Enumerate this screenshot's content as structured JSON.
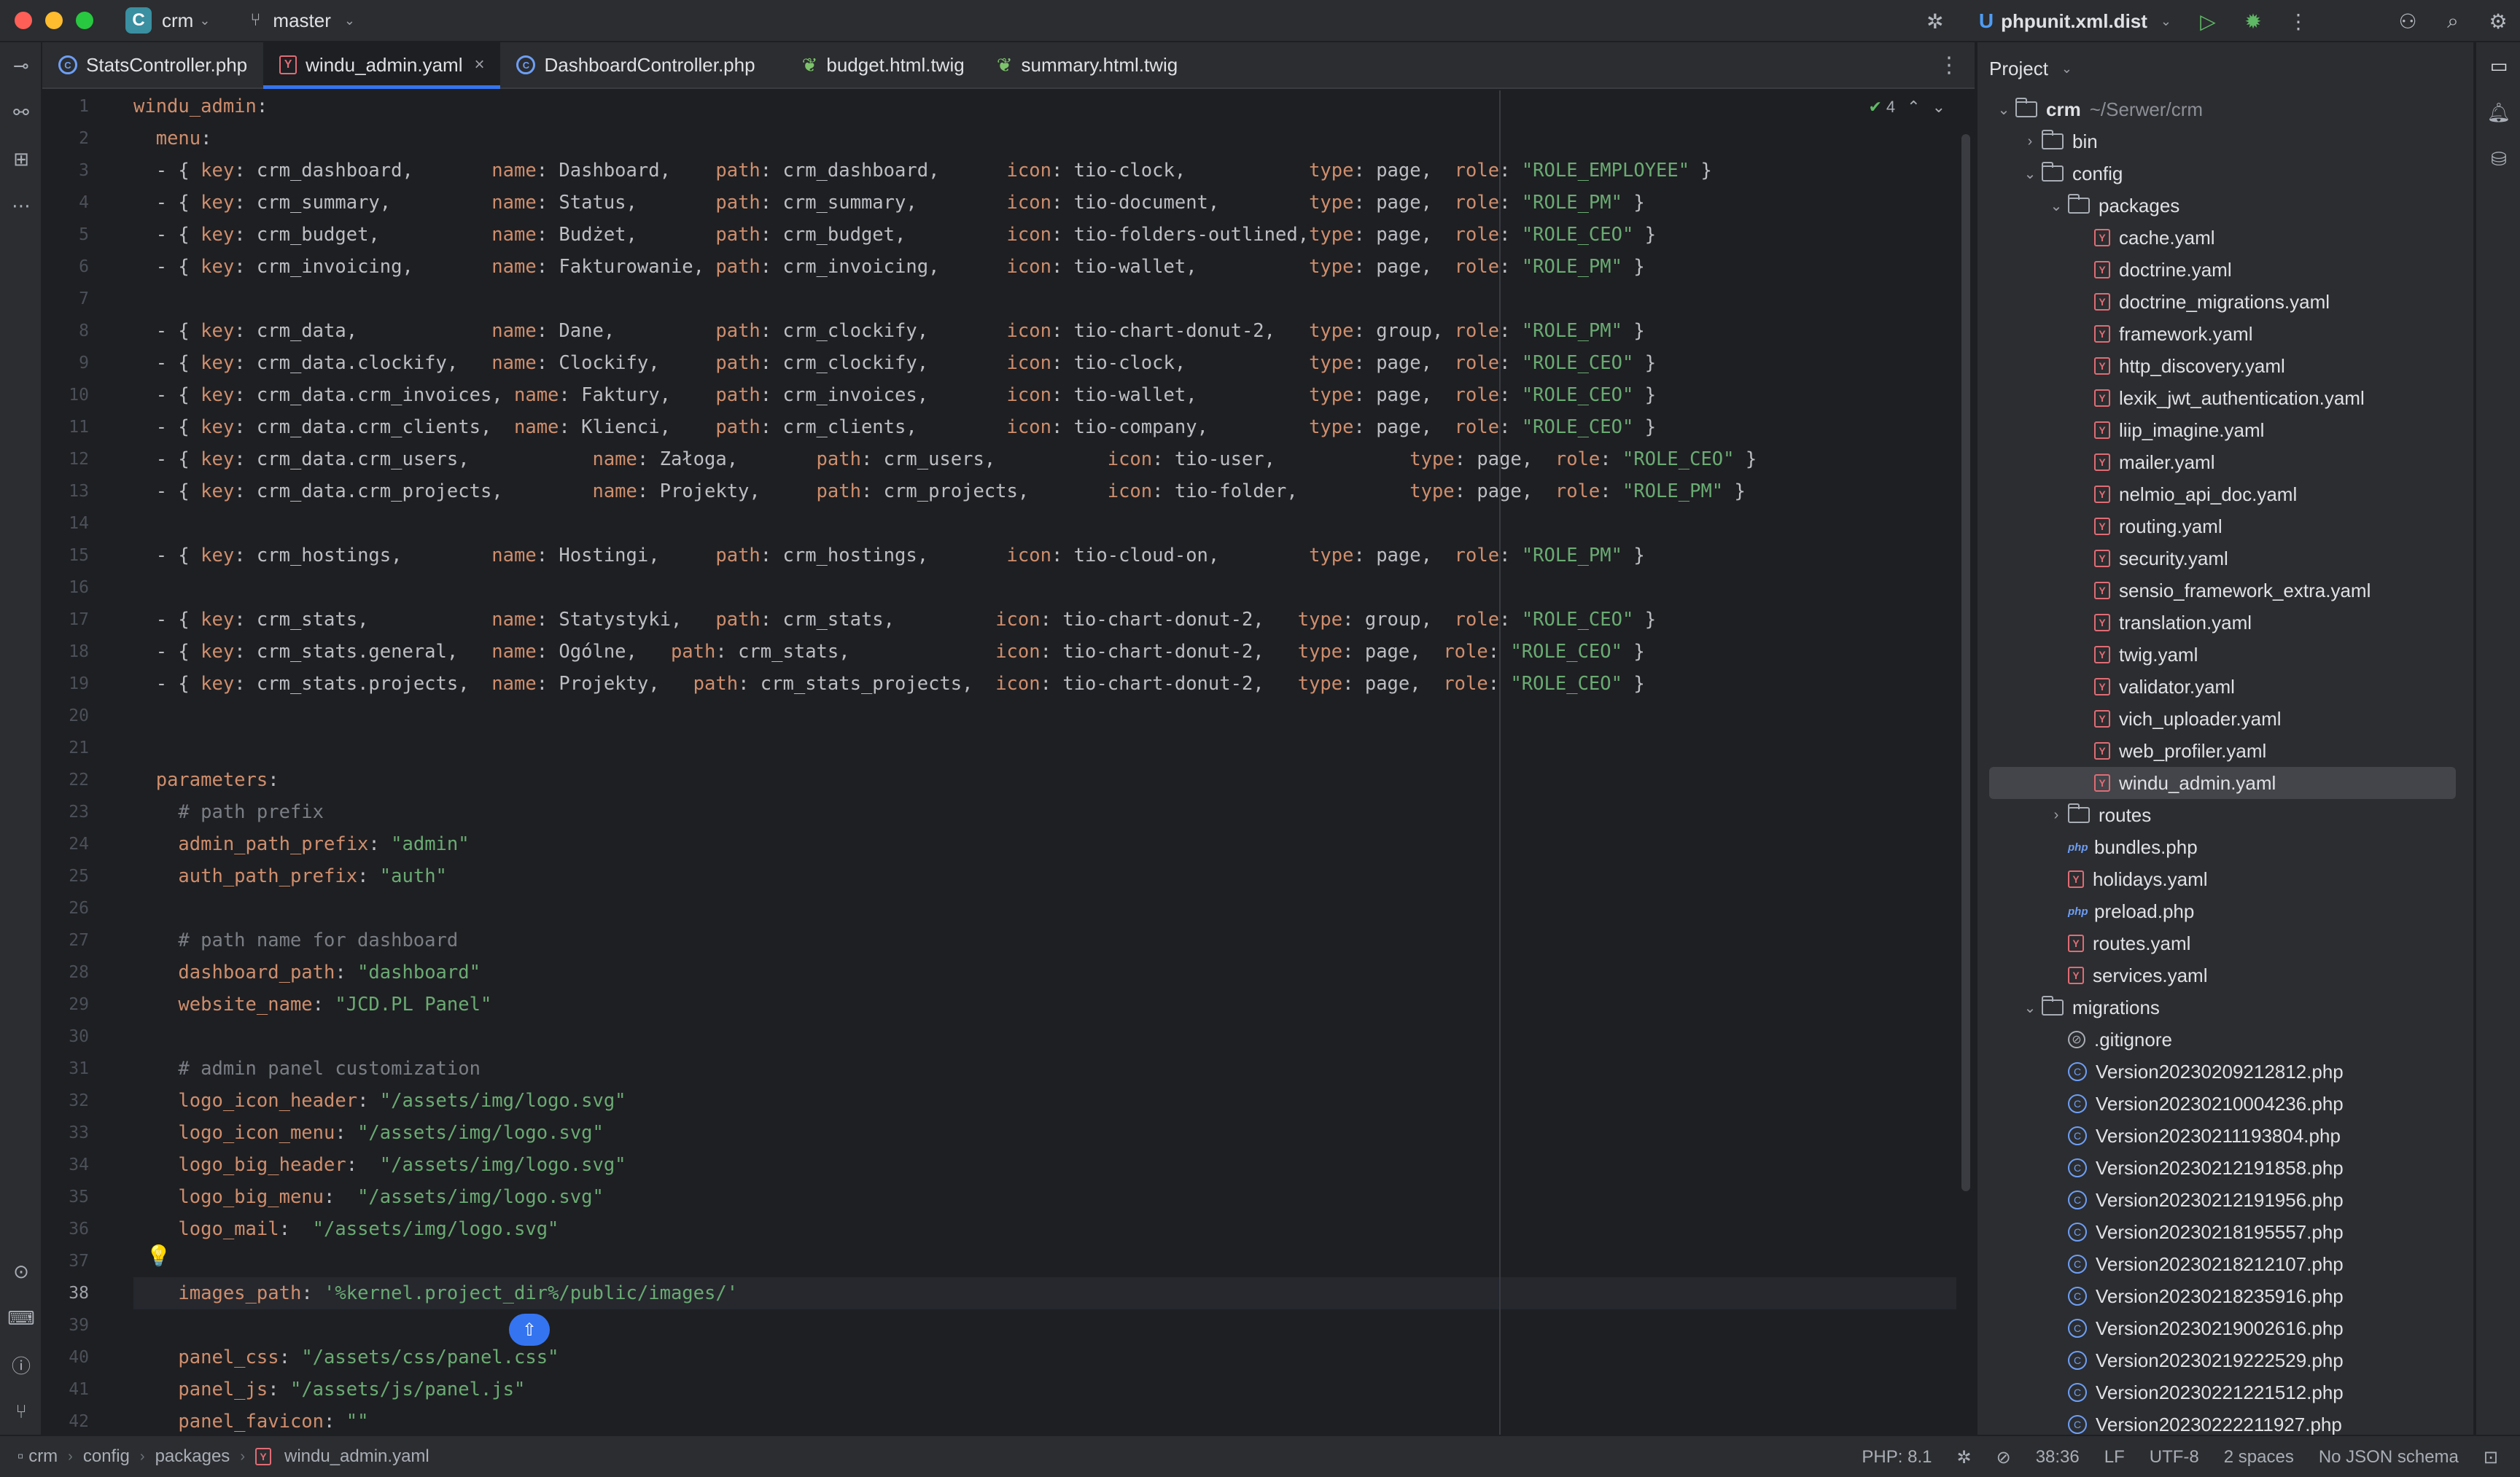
{
  "titlebar": {
    "project_badge": "C",
    "project_name": "crm",
    "branch": "master",
    "run_config": "phpunit.xml.dist",
    "colors": {
      "accent": "#3574f0",
      "run": "#5fb865"
    }
  },
  "tabs": [
    {
      "label": "StatsController.php",
      "type": "php",
      "active": false
    },
    {
      "label": "windu_admin.yaml",
      "type": "yaml",
      "active": true
    },
    {
      "label": "DashboardController.php",
      "type": "php",
      "active": false
    },
    {
      "label": "budget.html.twig",
      "type": "twig",
      "active": false
    },
    {
      "label": "summary.html.twig",
      "type": "twig",
      "active": false
    }
  ],
  "editor": {
    "inspection_count": "4",
    "current_line": 38,
    "lines": [
      "windu_admin:",
      "  menu:",
      "  - { key: crm_dashboard,       name: Dashboard,    path: crm_dashboard,      icon: tio-clock,           type: page,  role: \"ROLE_EMPLOYEE\" }",
      "  - { key: crm_summary,         name: Status,       path: crm_summary,        icon: tio-document,        type: page,  role: \"ROLE_PM\" }",
      "  - { key: crm_budget,          name: Budżet,       path: crm_budget,         icon: tio-folders-outlined,type: page,  role: \"ROLE_CEO\" }",
      "  - { key: crm_invoicing,       name: Fakturowanie, path: crm_invoicing,      icon: tio-wallet,          type: page,  role: \"ROLE_PM\" }",
      "",
      "  - { key: crm_data,            name: Dane,         path: crm_clockify,       icon: tio-chart-donut-2,   type: group, role: \"ROLE_PM\" }",
      "  - { key: crm_data.clockify,   name: Clockify,     path: crm_clockify,       icon: tio-clock,           type: page,  role: \"ROLE_CEO\" }",
      "  - { key: crm_data.crm_invoices, name: Faktury,    path: crm_invoices,       icon: tio-wallet,          type: page,  role: \"ROLE_CEO\" }",
      "  - { key: crm_data.crm_clients,  name: Klienci,    path: crm_clients,        icon: tio-company,         type: page,  role: \"ROLE_CEO\" }",
      "  - { key: crm_data.crm_users,           name: Załoga,       path: crm_users,          icon: tio-user,            type: page,  role: \"ROLE_CEO\" }",
      "  - { key: crm_data.crm_projects,        name: Projekty,     path: crm_projects,       icon: tio-folder,          type: page,  role: \"ROLE_PM\" }",
      "",
      "  - { key: crm_hostings,        name: Hostingi,     path: crm_hostings,       icon: tio-cloud-on,        type: page,  role: \"ROLE_PM\" }",
      "",
      "  - { key: crm_stats,           name: Statystyki,   path: crm_stats,         icon: tio-chart-donut-2,   type: group,  role: \"ROLE_CEO\" }",
      "  - { key: crm_stats.general,   name: Ogólne,   path: crm_stats,             icon: tio-chart-donut-2,   type: page,  role: \"ROLE_CEO\" }",
      "  - { key: crm_stats.projects,  name: Projekty,   path: crm_stats_projects,  icon: tio-chart-donut-2,   type: page,  role: \"ROLE_CEO\" }",
      "",
      "",
      "  parameters:",
      "    # path prefix",
      "    admin_path_prefix: \"admin\"",
      "    auth_path_prefix: \"auth\"",
      "",
      "    # path name for dashboard",
      "    dashboard_path: \"dashboard\"",
      "    website_name: \"JCD.PL Panel\"",
      "",
      "    # admin panel customization",
      "    logo_icon_header: \"/assets/img/logo.svg\"",
      "    logo_icon_menu: \"/assets/img/logo.svg\"",
      "    logo_big_header:  \"/assets/img/logo.svg\"",
      "    logo_big_menu:  \"/assets/img/logo.svg\"",
      "    logo_mail:  \"/assets/img/logo.svg\"",
      "",
      "    images_path: '%kernel.project_dir%/public/images/'",
      "",
      "    panel_css: \"/assets/css/panel.css\"",
      "    panel_js: \"/assets/js/panel.js\"",
      "    panel_favicon: \"\""
    ]
  },
  "project": {
    "title": "Project",
    "tree": [
      {
        "label": "crm",
        "extra": "~/Serwer/crm",
        "depth": 0,
        "kind": "folder",
        "open": true
      },
      {
        "label": "bin",
        "depth": 1,
        "kind": "folder",
        "open": false
      },
      {
        "label": "config",
        "depth": 1,
        "kind": "folder",
        "open": true
      },
      {
        "label": "packages",
        "depth": 2,
        "kind": "folder",
        "open": true
      },
      {
        "label": "cache.yaml",
        "depth": 3,
        "kind": "yaml"
      },
      {
        "label": "doctrine.yaml",
        "depth": 3,
        "kind": "yaml"
      },
      {
        "label": "doctrine_migrations.yaml",
        "depth": 3,
        "kind": "yaml"
      },
      {
        "label": "framework.yaml",
        "depth": 3,
        "kind": "yaml"
      },
      {
        "label": "http_discovery.yaml",
        "depth": 3,
        "kind": "yaml"
      },
      {
        "label": "lexik_jwt_authentication.yaml",
        "depth": 3,
        "kind": "yaml"
      },
      {
        "label": "liip_imagine.yaml",
        "depth": 3,
        "kind": "yaml"
      },
      {
        "label": "mailer.yaml",
        "depth": 3,
        "kind": "yaml"
      },
      {
        "label": "nelmio_api_doc.yaml",
        "depth": 3,
        "kind": "yaml"
      },
      {
        "label": "routing.yaml",
        "depth": 3,
        "kind": "yaml"
      },
      {
        "label": "security.yaml",
        "depth": 3,
        "kind": "yaml"
      },
      {
        "label": "sensio_framework_extra.yaml",
        "depth": 3,
        "kind": "yaml"
      },
      {
        "label": "translation.yaml",
        "depth": 3,
        "kind": "yaml"
      },
      {
        "label": "twig.yaml",
        "depth": 3,
        "kind": "yaml"
      },
      {
        "label": "validator.yaml",
        "depth": 3,
        "kind": "yaml"
      },
      {
        "label": "vich_uploader.yaml",
        "depth": 3,
        "kind": "yaml"
      },
      {
        "label": "web_profiler.yaml",
        "depth": 3,
        "kind": "yaml"
      },
      {
        "label": "windu_admin.yaml",
        "depth": 3,
        "kind": "yaml",
        "selected": true
      },
      {
        "label": "routes",
        "depth": 2,
        "kind": "folder",
        "open": false
      },
      {
        "label": "bundles.php",
        "depth": 2,
        "kind": "php"
      },
      {
        "label": "holidays.yaml",
        "depth": 2,
        "kind": "yaml"
      },
      {
        "label": "preload.php",
        "depth": 2,
        "kind": "php"
      },
      {
        "label": "routes.yaml",
        "depth": 2,
        "kind": "yaml"
      },
      {
        "label": "services.yaml",
        "depth": 2,
        "kind": "yaml"
      },
      {
        "label": "migrations",
        "depth": 1,
        "kind": "folder",
        "open": true
      },
      {
        "label": ".gitignore",
        "depth": 2,
        "kind": "git"
      },
      {
        "label": "Version20230209212812.php",
        "depth": 2,
        "kind": "mig"
      },
      {
        "label": "Version20230210004236.php",
        "depth": 2,
        "kind": "mig"
      },
      {
        "label": "Version20230211193804.php",
        "depth": 2,
        "kind": "mig"
      },
      {
        "label": "Version20230212191858.php",
        "depth": 2,
        "kind": "mig"
      },
      {
        "label": "Version20230212191956.php",
        "depth": 2,
        "kind": "mig"
      },
      {
        "label": "Version20230218195557.php",
        "depth": 2,
        "kind": "mig"
      },
      {
        "label": "Version20230218212107.php",
        "depth": 2,
        "kind": "mig"
      },
      {
        "label": "Version20230218235916.php",
        "depth": 2,
        "kind": "mig"
      },
      {
        "label": "Version20230219002616.php",
        "depth": 2,
        "kind": "mig"
      },
      {
        "label": "Version20230219222529.php",
        "depth": 2,
        "kind": "mig"
      },
      {
        "label": "Version20230221221512.php",
        "depth": 2,
        "kind": "mig"
      },
      {
        "label": "Version20230222211927.php",
        "depth": 2,
        "kind": "mig"
      }
    ]
  },
  "statusbar": {
    "breadcrumbs": [
      "crm",
      "config",
      "packages",
      "windu_admin.yaml"
    ],
    "php_version": "PHP: 8.1",
    "position": "38:36",
    "line_sep": "LF",
    "encoding": "UTF-8",
    "indent": "2 spaces",
    "schema": "No JSON schema"
  }
}
